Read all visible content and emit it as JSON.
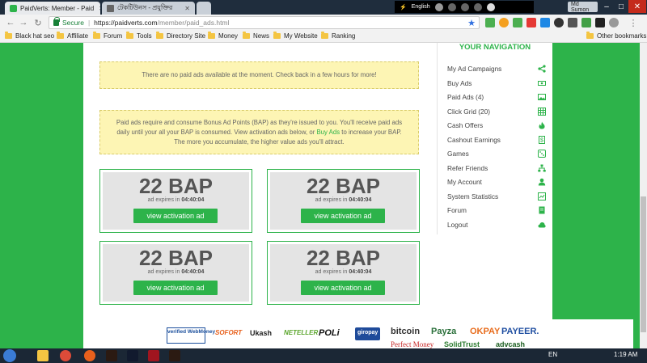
{
  "browser": {
    "tabs": [
      {
        "title": "PaidVerts: Member - Paid",
        "active": true
      },
      {
        "title": "টেকটিউনস - প্রযুক্তির",
        "active": false
      }
    ],
    "tray": {
      "language": "English"
    },
    "user_chip": "Md Sumon",
    "address": {
      "secure_label": "Secure",
      "host": "https://paidverts.com",
      "path": "/member/paid_ads.html"
    },
    "bookmarks": [
      "Black hat seo",
      "Affiliate",
      "Forum",
      "Tools",
      "Directory Site",
      "Money",
      "News",
      "My Website",
      "Ranking"
    ],
    "other_bookmarks": "Other bookmarks"
  },
  "page": {
    "notice_no_ads": "There are no paid ads available at the moment. Check back in a few hours for more!",
    "bap_info": {
      "line1": "Paid ads require and consume Bonus Ad Points (BAP) as they're issued to you. You'll receive paid ads",
      "line2_pre": "daily until your all your BAP is consumed. View activation ads below, or ",
      "line2_link": "Buy Ads",
      "line2_post": " to increase your BAP.",
      "line3": "The more you accumulate, the higher value ads you'll attract."
    },
    "cards": [
      {
        "bap": "22 BAP",
        "expires_label": "ad expires in",
        "expires_time": "04:40:04",
        "button": "view activation ad"
      },
      {
        "bap": "22 BAP",
        "expires_label": "ad expires in",
        "expires_time": "04:40:04",
        "button": "view activation ad"
      },
      {
        "bap": "22 BAP",
        "expires_label": "ad expires in",
        "expires_time": "04:40:04",
        "button": "view activation ad"
      },
      {
        "bap": "22 BAP",
        "expires_label": "ad expires in",
        "expires_time": "04:40:04",
        "button": "view activation ad"
      }
    ]
  },
  "sidenav": {
    "title": "YOUR NAVIGATION",
    "items": [
      {
        "label": "My Ad Campaigns",
        "icon": "share-icon"
      },
      {
        "label": "Buy Ads",
        "icon": "cash-icon"
      },
      {
        "label": "Paid Ads (4)",
        "icon": "image-icon"
      },
      {
        "label": "Click Grid (20)",
        "icon": "grid-icon"
      },
      {
        "label": "Cash Offers",
        "icon": "fire-icon"
      },
      {
        "label": "Cashout Earnings",
        "icon": "dollar-icon"
      },
      {
        "label": "Games",
        "icon": "dice-icon"
      },
      {
        "label": "Refer Friends",
        "icon": "sitemap-icon"
      },
      {
        "label": "My Account",
        "icon": "user-icon"
      },
      {
        "label": "System Statistics",
        "icon": "chart-icon"
      },
      {
        "label": "Forum",
        "icon": "book-icon"
      },
      {
        "label": "Logout",
        "icon": "cloud-icon"
      }
    ]
  },
  "footer": {
    "payments": [
      "verified WebMoney",
      "SOFORT",
      "Ukash",
      "NETELLER",
      "POLi",
      "giropay",
      "bitcoin",
      "Payza",
      "OKPAY",
      "PAYEER.",
      "Perfect Money",
      "SolidTrust",
      "advcash"
    ]
  },
  "taskbar": {
    "language": "EN",
    "time": "1:19 AM"
  },
  "colors": {
    "brand_green": "#2db34a",
    "notice_yellow": "#fdf5b4"
  }
}
